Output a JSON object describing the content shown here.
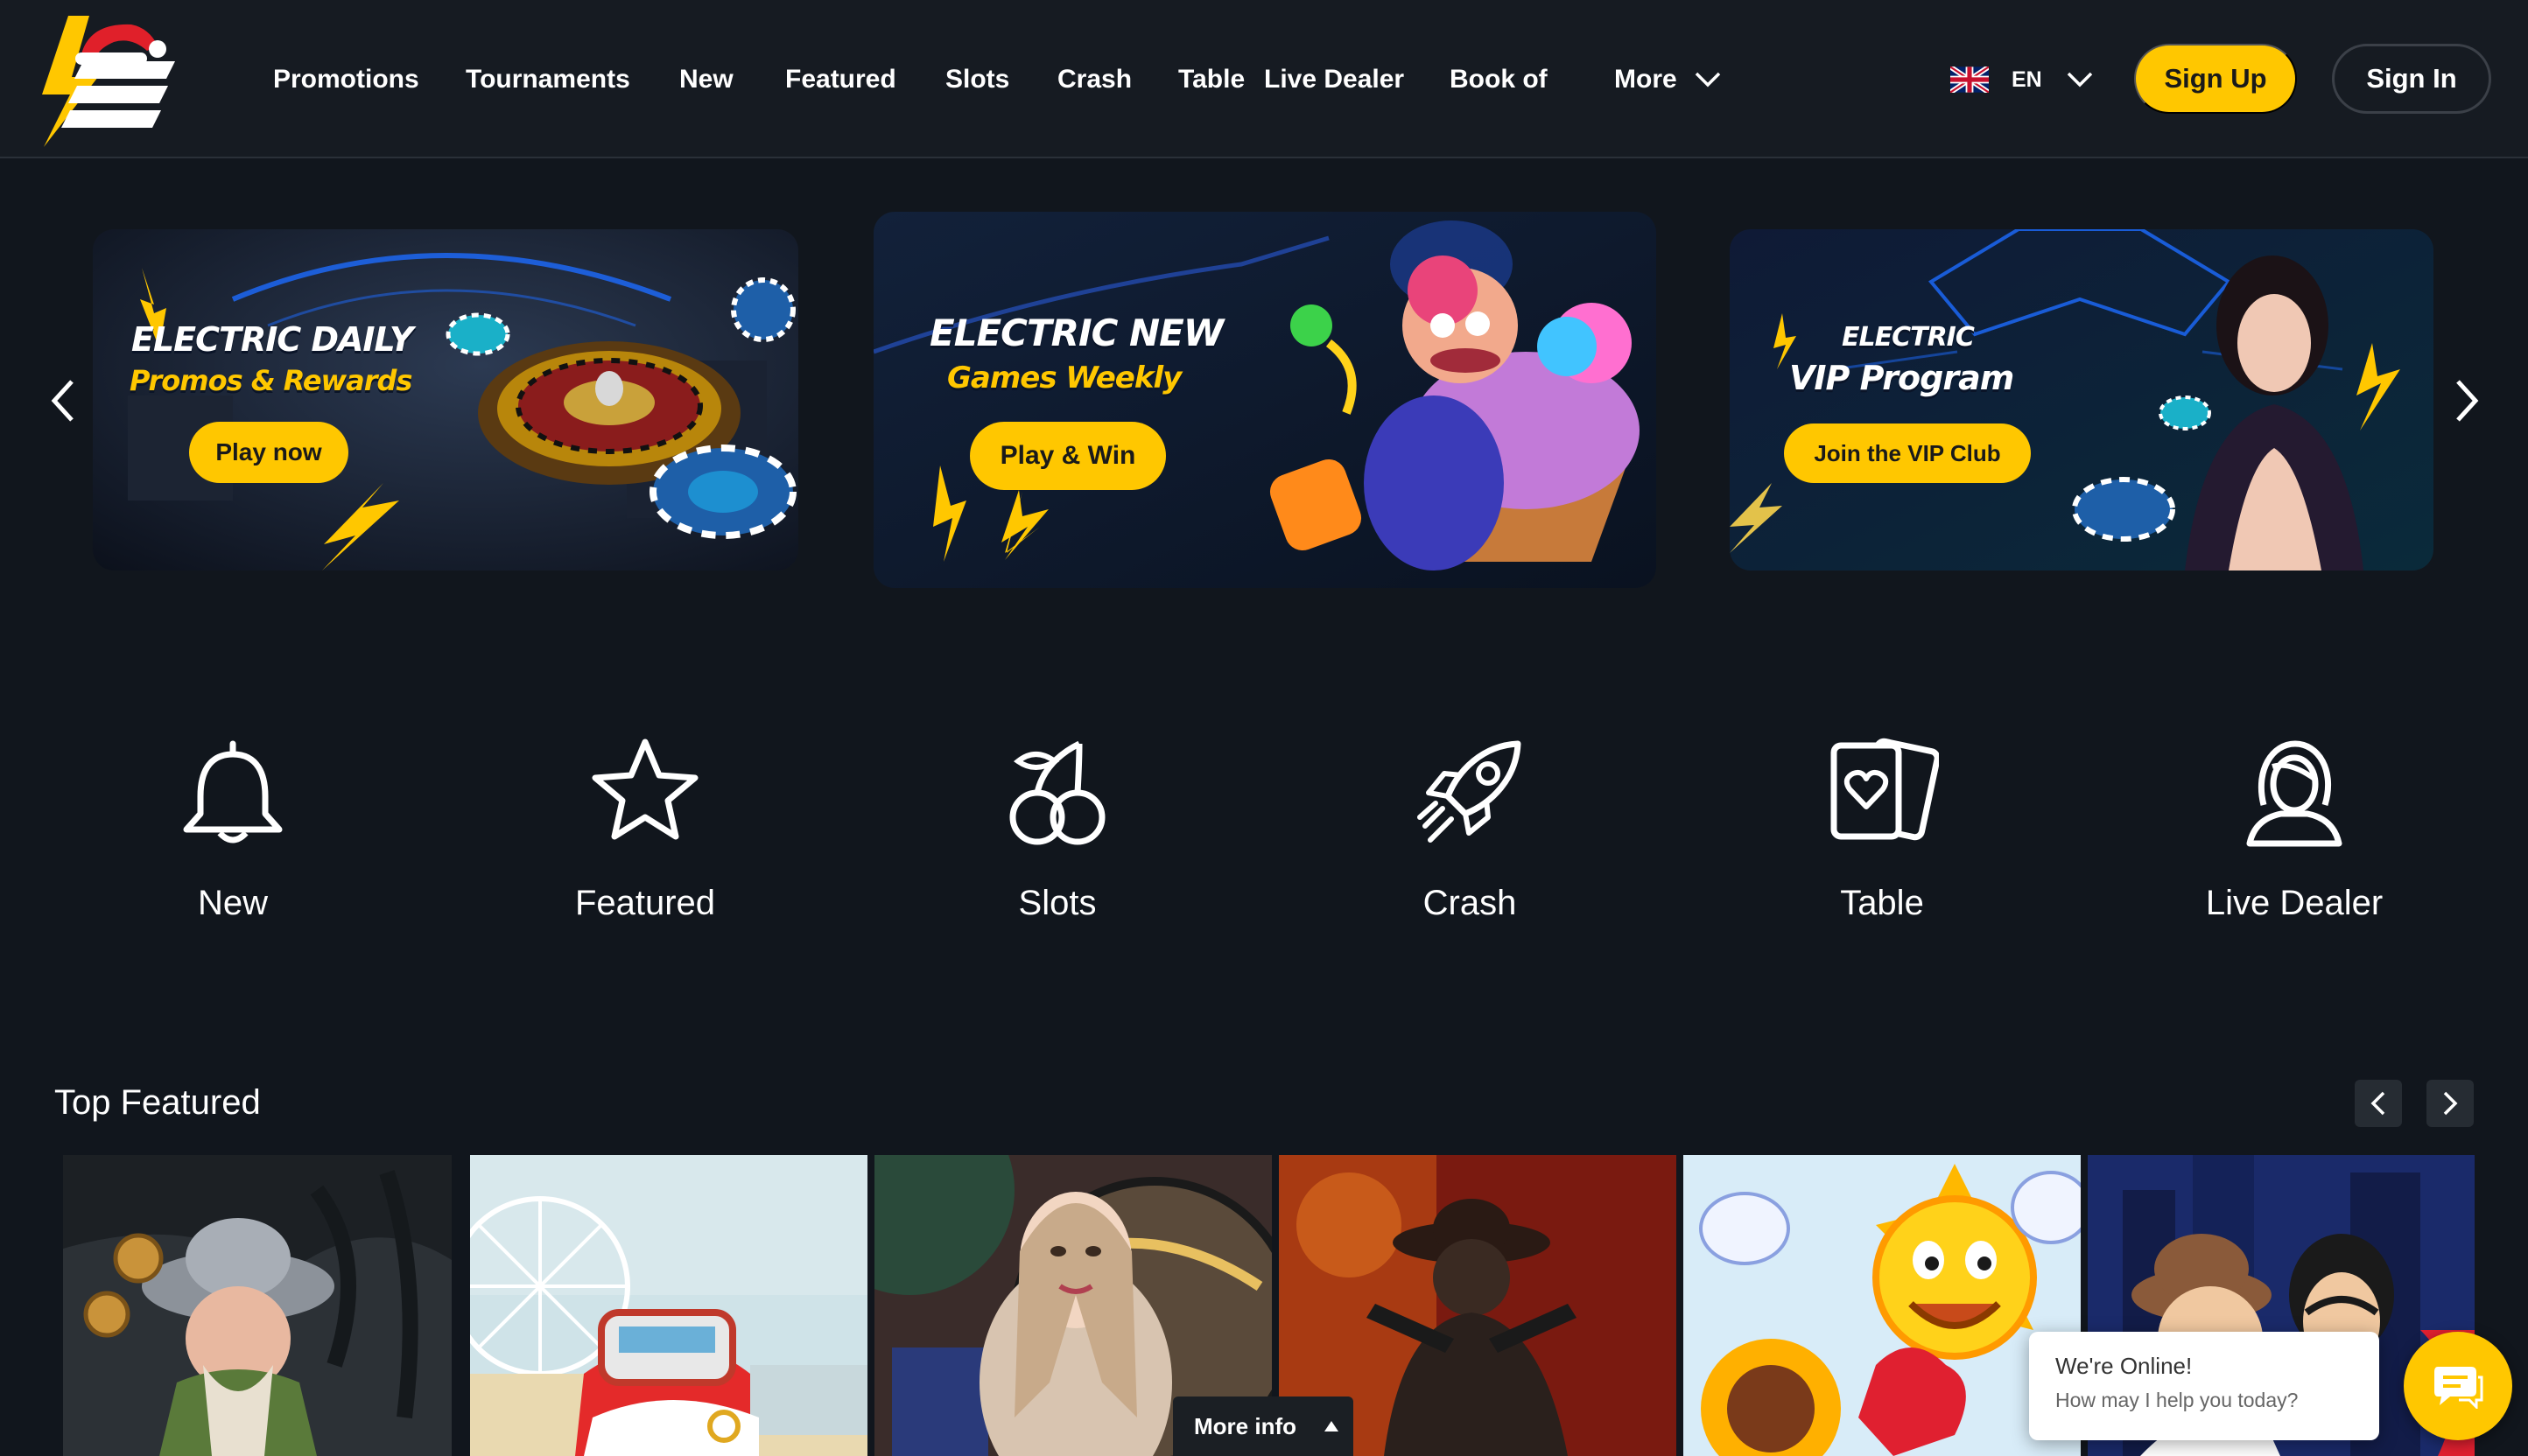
{
  "header": {
    "nav": [
      {
        "label": "Promotions"
      },
      {
        "label": "Tournaments"
      },
      {
        "label": "New"
      },
      {
        "label": "Featured"
      },
      {
        "label": "Slots"
      },
      {
        "label": "Crash"
      },
      {
        "label": "Table"
      },
      {
        "label": "Live Dealer"
      },
      {
        "label": "Book of"
      },
      {
        "label": "More"
      }
    ],
    "language": {
      "code": "EN",
      "flag_icon": "uk-flag-icon"
    },
    "sign_up": "Sign Up",
    "sign_in": "Sign In"
  },
  "banners": [
    {
      "title": "ELECTRIC DAILY",
      "subtitle": "Promos & Rewards",
      "button": "Play now"
    },
    {
      "title": "ELECTRIC NEW",
      "subtitle": "Games Weekly",
      "button": "Play & Win"
    },
    {
      "title": "ELECTRIC",
      "subtitle": "VIP Program",
      "button": "Join the VIP Club"
    }
  ],
  "categories": [
    {
      "label": "New",
      "icon": "bell-icon"
    },
    {
      "label": "Featured",
      "icon": "star-icon"
    },
    {
      "label": "Slots",
      "icon": "cherries-icon"
    },
    {
      "label": "Crash",
      "icon": "rocket-icon"
    },
    {
      "label": "Table",
      "icon": "cards-icon"
    },
    {
      "label": "Live Dealer",
      "icon": "dealer-icon"
    }
  ],
  "top_featured": {
    "title": "Top Featured",
    "more_info": "More info"
  },
  "chat": {
    "title": "We're Online!",
    "subtitle": "How may I help you today?"
  },
  "colors": {
    "accent": "#ffc700",
    "background": "#11161d",
    "header": "#161b22"
  }
}
